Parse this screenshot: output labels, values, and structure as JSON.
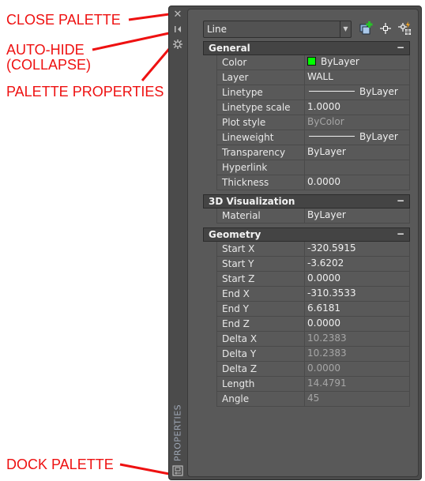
{
  "annotations": {
    "close_palette": "CLOSE PALETTE",
    "auto_hide": "AUTO-HIDE\n(COLLAPSE)",
    "palette_properties": "PALETTE PROPERTIES",
    "dock_palette": "DOCK PALETTE",
    "color": "#ee1111"
  },
  "palette": {
    "title": "PROPERTIES",
    "titlebar_icons": [
      "close-icon",
      "auto-hide-icon",
      "palette-properties-icon",
      "dock-palette-icon"
    ],
    "object_type": "Line",
    "toolbar_icons": [
      "toggle-pickadd-icon",
      "select-objects-icon",
      "quick-select-icon"
    ],
    "categories": [
      {
        "name": "General",
        "toggle": "−",
        "rows": [
          {
            "key": "Color",
            "value": "ByLayer",
            "swatch": "#00ff00",
            "readonly": false
          },
          {
            "key": "Layer",
            "value": "WALL",
            "readonly": false
          },
          {
            "key": "Linetype",
            "value": "ByLayer",
            "line": true,
            "readonly": false
          },
          {
            "key": "Linetype scale",
            "value": "1.0000",
            "readonly": false
          },
          {
            "key": "Plot style",
            "value": "ByColor",
            "readonly": true
          },
          {
            "key": "Lineweight",
            "value": "ByLayer",
            "line": true,
            "readonly": false
          },
          {
            "key": "Transparency",
            "value": "ByLayer",
            "readonly": false
          },
          {
            "key": "Hyperlink",
            "value": "",
            "readonly": false
          },
          {
            "key": "Thickness",
            "value": "0.0000",
            "readonly": false
          }
        ]
      },
      {
        "name": "3D Visualization",
        "toggle": "−",
        "rows": [
          {
            "key": "Material",
            "value": "ByLayer",
            "readonly": false
          }
        ]
      },
      {
        "name": "Geometry",
        "toggle": "−",
        "rows": [
          {
            "key": "Start X",
            "value": "-320.5915",
            "readonly": false
          },
          {
            "key": "Start Y",
            "value": "-3.6202",
            "readonly": false
          },
          {
            "key": "Start Z",
            "value": "0.0000",
            "readonly": false
          },
          {
            "key": "End X",
            "value": "-310.3533",
            "readonly": false
          },
          {
            "key": "End Y",
            "value": "6.6181",
            "readonly": false
          },
          {
            "key": "End Z",
            "value": "0.0000",
            "readonly": false
          },
          {
            "key": "Delta X",
            "value": "10.2383",
            "readonly": true
          },
          {
            "key": "Delta Y",
            "value": "10.2383",
            "readonly": true
          },
          {
            "key": "Delta Z",
            "value": "0.0000",
            "readonly": true
          },
          {
            "key": "Length",
            "value": "14.4791",
            "readonly": true
          },
          {
            "key": "Angle",
            "value": "45",
            "readonly": true
          }
        ]
      }
    ]
  }
}
